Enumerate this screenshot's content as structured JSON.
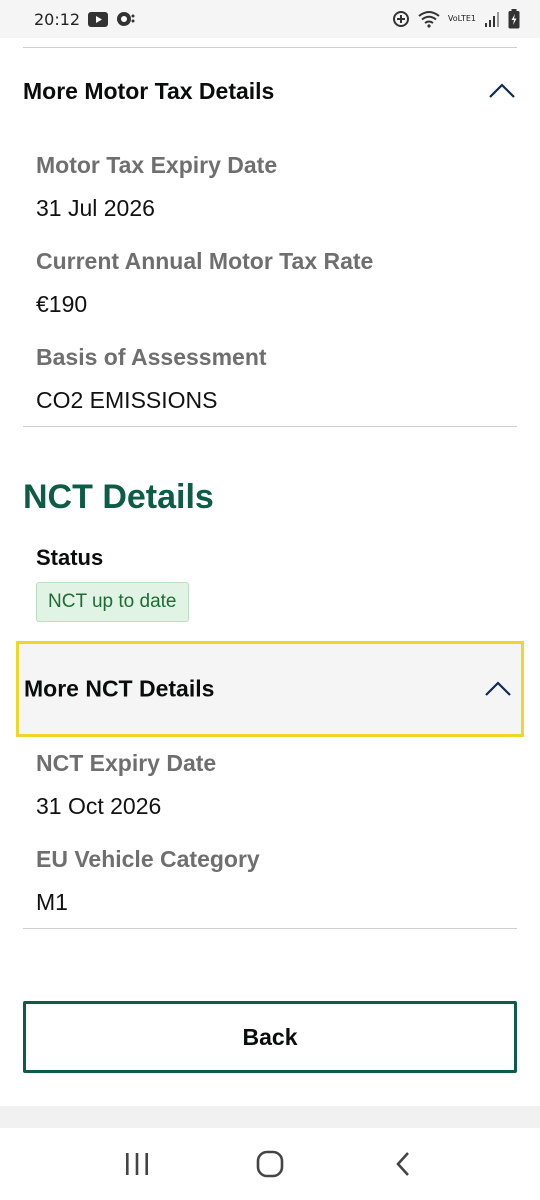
{
  "status_bar": {
    "time": "20:12",
    "network_label": "VoLTE1",
    "icons": [
      "youtube-icon",
      "chat-icon",
      "data-saver-icon",
      "wifi-icon",
      "signal-icon",
      "battery-charging-icon"
    ]
  },
  "motor_tax_accordion": {
    "title": "More Motor Tax Details",
    "expanded": true,
    "fields": [
      {
        "label": "Motor Tax Expiry Date",
        "value": "31 Jul 2026"
      },
      {
        "label": "Current Annual Motor Tax Rate",
        "value": "€190"
      },
      {
        "label": "Basis of Assessment",
        "value": "CO2 EMISSIONS"
      }
    ]
  },
  "nct_section": {
    "title": "NCT Details",
    "status_label": "Status",
    "status_tag": "NCT up to date",
    "accordion": {
      "title": "More NCT Details",
      "expanded": true,
      "fields": [
        {
          "label": "NCT Expiry Date",
          "value": "31 Oct 2026"
        },
        {
          "label": "EU Vehicle Category",
          "value": "M1"
        }
      ]
    }
  },
  "back_button": {
    "label": "Back"
  },
  "colors": {
    "brand_green": "#0c5c46",
    "focus_yellow": "#f0d52a",
    "tag_bg": "#e1f3e4",
    "tag_text": "#1e6b35"
  },
  "nav_bar": {
    "icons": [
      "recent-apps-icon",
      "home-icon",
      "back-icon"
    ]
  }
}
